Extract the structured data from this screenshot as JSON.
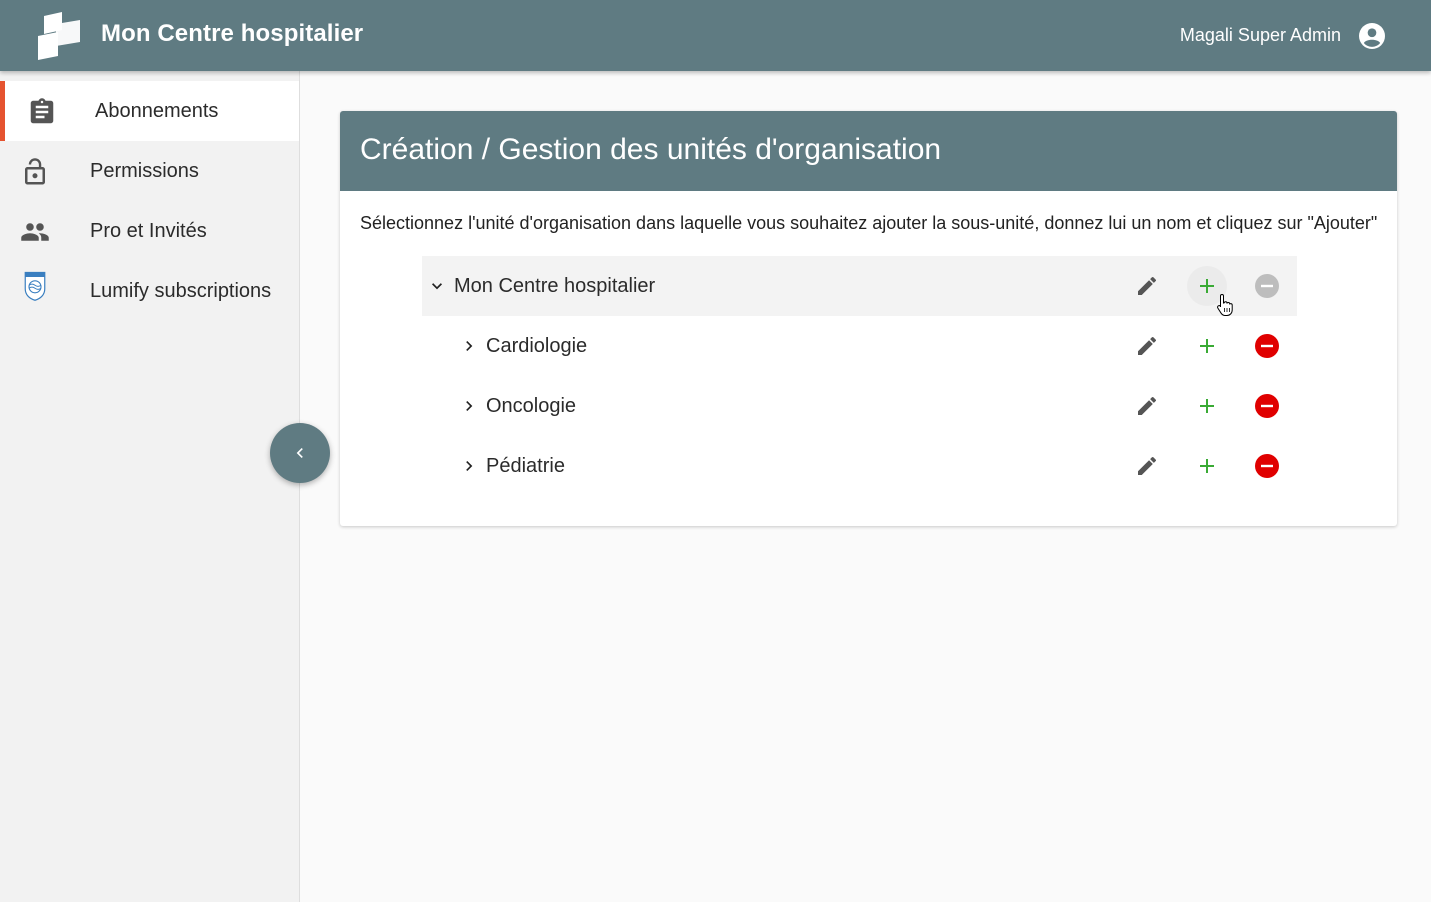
{
  "header": {
    "app_title": "Mon Centre hospitalier",
    "user_name": "Magali Super Admin",
    "logo_icon": "stacked-pages-logo",
    "account_icon": "account-circle-icon"
  },
  "sidebar": {
    "items": [
      {
        "label": "Abonnements",
        "icon": "clipboard-icon",
        "active": true
      },
      {
        "label": "Permissions",
        "icon": "lock-icon",
        "active": false
      },
      {
        "label": "Pro et Invités",
        "icon": "people-icon",
        "active": false
      },
      {
        "label": "Lumify subscriptions",
        "icon": "philips-shield-icon",
        "active": false
      }
    ],
    "collapse_icon": "chevron-left-icon"
  },
  "main": {
    "title": "Création / Gestion des unités d'organisation",
    "description": "Sélectionnez l'unité d'organisation dans laquelle vous souhaitez ajouter la sous-unité, donnez lui un nom et cliquez sur \"Ajouter\"",
    "tree": [
      {
        "name": "Mon Centre hospitalier",
        "expanded": true,
        "level": 0,
        "delete_enabled": false
      },
      {
        "name": "Cardiologie",
        "expanded": false,
        "level": 1,
        "delete_enabled": true
      },
      {
        "name": "Oncologie",
        "expanded": false,
        "level": 1,
        "delete_enabled": true
      },
      {
        "name": "Pédiatrie",
        "expanded": false,
        "level": 1,
        "delete_enabled": true
      }
    ]
  },
  "colors": {
    "primary": "#5f7b82",
    "accent": "#e5532f",
    "add": "#3aaa35",
    "delete": "#e00000",
    "disabled": "#bdbdbd"
  }
}
